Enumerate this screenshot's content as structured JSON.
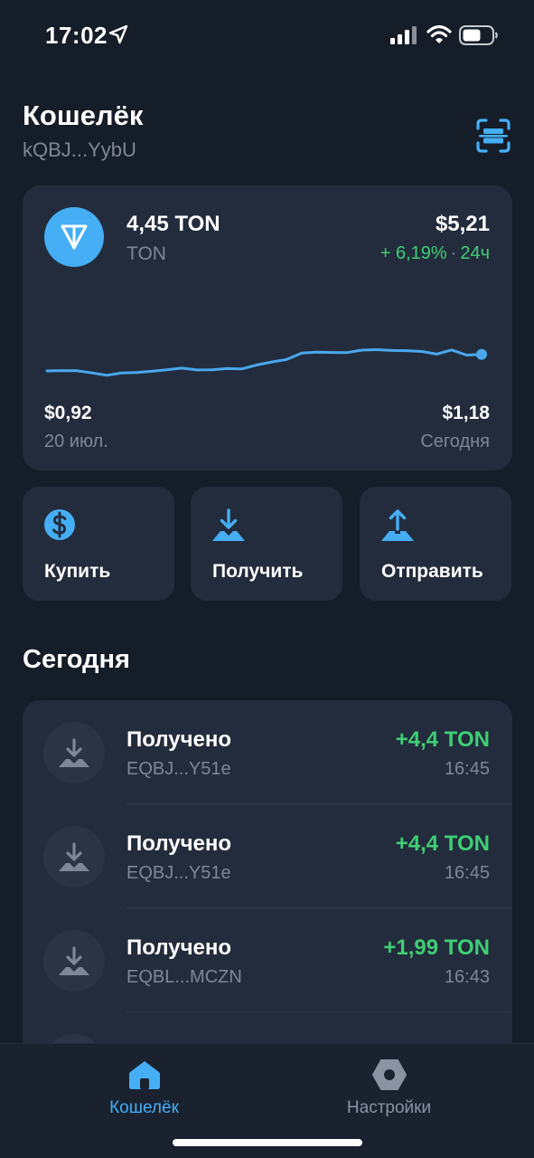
{
  "status_bar": {
    "time": "17:02"
  },
  "header": {
    "title": "Кошелёк",
    "address": "kQBJ...YybU"
  },
  "balance": {
    "amount": "4,45 TON",
    "currency": "TON",
    "usd_value": "$5,21",
    "change_percent": "+ 6,19%",
    "change_period": "24ч",
    "low_price": "$0,92",
    "low_date": "20 июл.",
    "high_price": "$1,18",
    "high_date": "Сегодня"
  },
  "chart_data": {
    "type": "line",
    "title": "",
    "xlabel": "",
    "ylabel": "",
    "ylim": [
      0.92,
      1.18
    ],
    "series": [
      {
        "values": [
          0.92,
          0.922,
          0.921,
          0.91,
          0.898,
          0.91,
          0.912,
          0.918,
          0.926,
          0.934,
          0.925,
          0.926,
          0.932,
          0.93,
          0.95,
          0.965,
          0.978,
          1.01,
          1.015,
          1.013,
          1.012,
          1.025,
          1.027,
          1.023,
          1.022,
          1.018,
          1.005,
          1.026,
          1.0,
          1.003
        ]
      }
    ],
    "colors": {
      "line": "#4aa8ee"
    }
  },
  "actions": [
    {
      "label": "Купить",
      "icon": "dollar-icon"
    },
    {
      "label": "Получить",
      "icon": "receive-arrow-icon"
    },
    {
      "label": "Отправить",
      "icon": "send-arrow-icon"
    }
  ],
  "section_title": "Сегодня",
  "transactions": [
    {
      "title": "Получено",
      "address": "EQBJ...Y51e",
      "amount": "+4,4 TON",
      "time": "16:45"
    },
    {
      "title": "Получено",
      "address": "EQBJ...Y51e",
      "amount": "+4,4 TON",
      "time": "16:45"
    },
    {
      "title": "Получено",
      "address": "EQBL...MCZN",
      "amount": "+1,99 TON",
      "time": "16:43"
    }
  ],
  "tabs": [
    {
      "label": "Кошелёк",
      "icon": "home-icon",
      "active": true
    },
    {
      "label": "Настройки",
      "icon": "settings-icon",
      "active": false
    }
  ],
  "colors": {
    "background": "#151d29",
    "card": "#222c3c",
    "accent": "#45aef5",
    "positive": "#3fce74",
    "muted": "#7d8796"
  }
}
